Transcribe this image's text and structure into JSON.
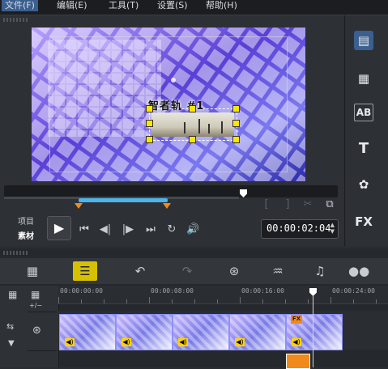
{
  "menubar": {
    "items": [
      "文件(F)",
      "编辑(E)",
      "工具(T)",
      "设置(S)",
      "帮助(H)"
    ]
  },
  "preview": {
    "title_text": "智者轨 #1",
    "mode_labels": [
      "项目",
      "素材"
    ],
    "timecode": "00:00:02:04"
  },
  "timeline": {
    "ruler_labels": [
      "00:00:00:00",
      "00:00:08:00",
      "00:00:16:00",
      "00:00:24:00"
    ],
    "fx_badge": "FX",
    "zoom_label": "+/−"
  },
  "right_tools": {
    "title_tool": "T",
    "fx_tool": "FX",
    "ab_tool": "AB"
  },
  "colors": {
    "accent_yellow": "#d6c000",
    "trim_blue": "#4fb4e8",
    "trim_orange": "#f08a1c",
    "handle_yellow": "#ffe600"
  }
}
